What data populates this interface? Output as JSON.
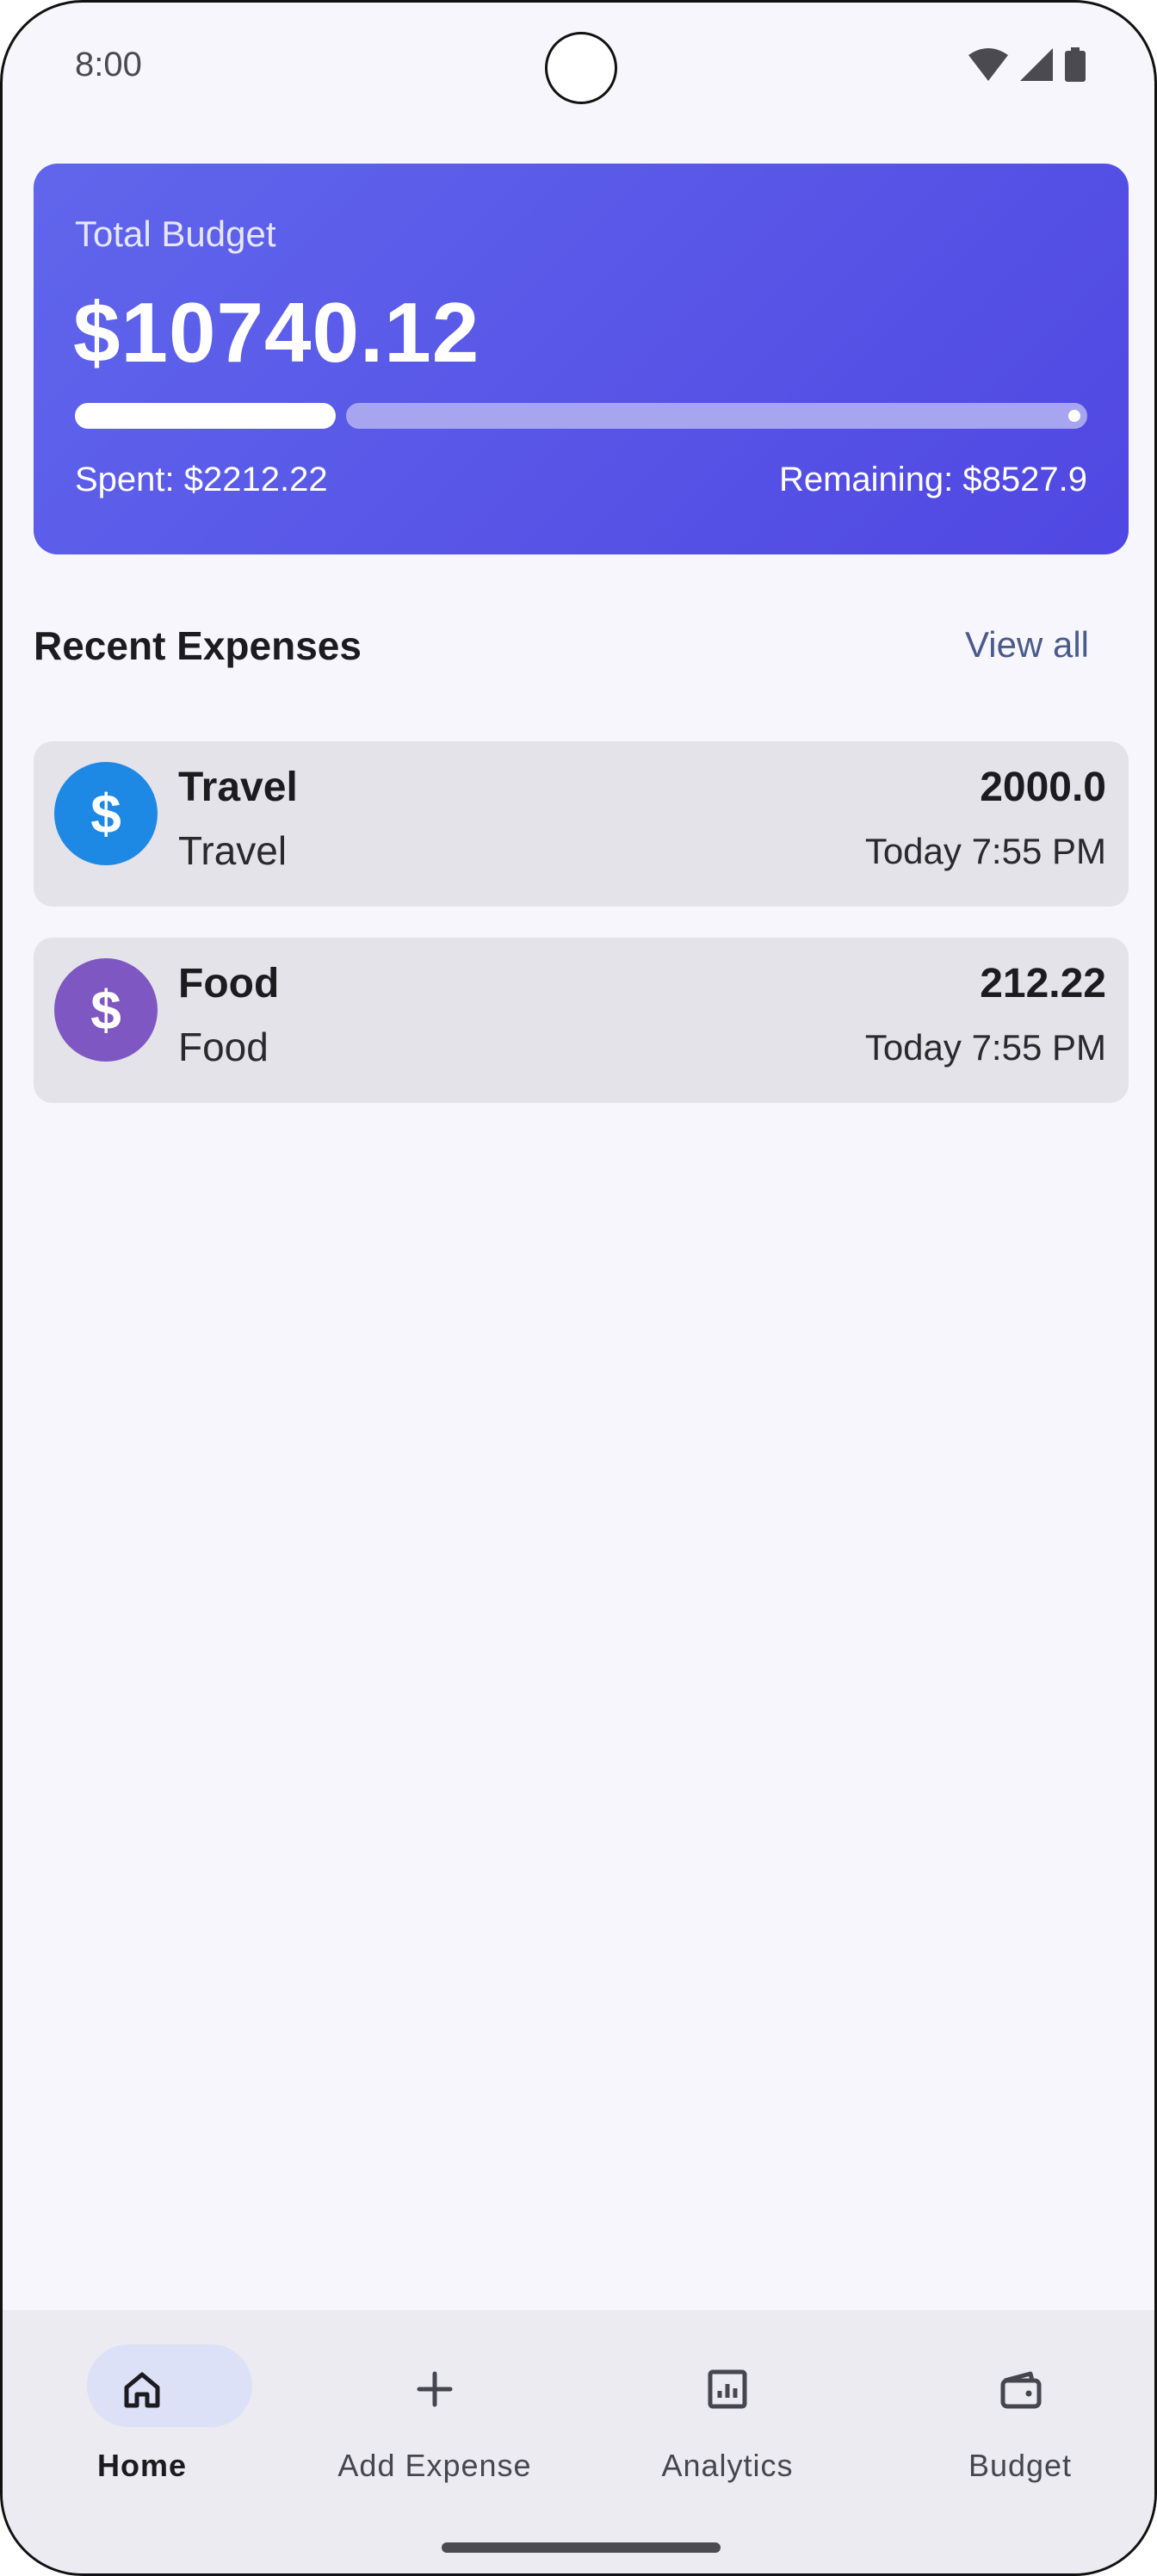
{
  "status_bar": {
    "time": "8:00"
  },
  "budget_card": {
    "label": "Total Budget",
    "amount": "$10740.12",
    "spent": "Spent: $2212.22",
    "remaining": "Remaining: $8527.9",
    "progress_fraction": 0.206
  },
  "recent": {
    "title": "Recent Expenses",
    "view_all": "View all",
    "items": [
      {
        "title": "Travel",
        "category": "Travel",
        "amount": "2000.0",
        "time": "Today 7:55 PM",
        "icon": "dollar-icon",
        "color": "#1e88e5"
      },
      {
        "title": "Food",
        "category": "Food",
        "amount": "212.22",
        "time": "Today 7:55 PM",
        "icon": "dollar-icon",
        "color": "#7e57c2"
      }
    ]
  },
  "nav": {
    "items": [
      {
        "label": "Home",
        "icon": "home-icon",
        "active": true
      },
      {
        "label": "Add Expense",
        "icon": "add-icon",
        "active": false
      },
      {
        "label": "Analytics",
        "icon": "analytics-icon",
        "active": false
      },
      {
        "label": "Budget",
        "icon": "wallet-icon",
        "active": false
      }
    ]
  },
  "colors": {
    "card_start": "#6066ec",
    "card_end": "#5047e2",
    "accent_link": "#4a5a8c",
    "nav_active_pill": "#dde1f7"
  }
}
